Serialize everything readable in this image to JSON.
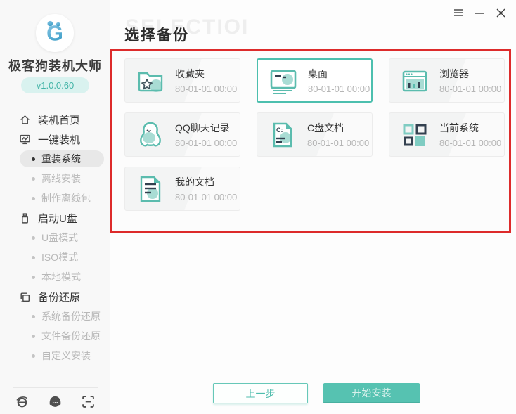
{
  "window": {
    "controls": {
      "menu": "menu",
      "minimize": "minimize",
      "close": "close"
    }
  },
  "sidebar": {
    "brand": "极客狗装机大师",
    "version": "v1.0.0.60",
    "nav": [
      {
        "label": "装机首页",
        "type": "section",
        "icon": "home-icon"
      },
      {
        "label": "一键装机",
        "type": "section",
        "icon": "monitor-icon"
      },
      {
        "label": "重装系统",
        "type": "sub",
        "selected": true
      },
      {
        "label": "离线安装",
        "type": "sub"
      },
      {
        "label": "制作离线包",
        "type": "sub"
      },
      {
        "label": "启动U盘",
        "type": "section",
        "icon": "usb-icon"
      },
      {
        "label": "U盘模式",
        "type": "sub"
      },
      {
        "label": "ISO模式",
        "type": "sub"
      },
      {
        "label": "本地模式",
        "type": "sub"
      },
      {
        "label": "备份还原",
        "type": "section",
        "icon": "restore-icon"
      },
      {
        "label": "系统备份还原",
        "type": "sub"
      },
      {
        "label": "文件备份还原",
        "type": "sub"
      },
      {
        "label": "自定义安装",
        "type": "sub"
      }
    ],
    "footer_icons": [
      "ie-browser-icon",
      "customer-service-icon",
      "scan-icon"
    ]
  },
  "main": {
    "watermark": "SELECTIOI",
    "title": "选择备份",
    "cards": [
      {
        "name": "收藏夹",
        "time": "80-01-01 00:00",
        "icon": "folder-star-icon",
        "selected": false
      },
      {
        "name": "桌面",
        "time": "80-01-01 00:00",
        "icon": "desktop-icon",
        "selected": true
      },
      {
        "name": "浏览器",
        "time": "80-01-01 00:00",
        "icon": "browser-icon",
        "selected": false
      },
      {
        "name": "QQ聊天记录",
        "time": "80-01-01 00:00",
        "icon": "qq-icon",
        "selected": false
      },
      {
        "name": "C盘文档",
        "time": "80-01-01 00:00",
        "icon": "c-drive-doc-icon",
        "selected": false
      },
      {
        "name": "当前系统",
        "time": "80-01-01 00:00",
        "icon": "system-grid-icon",
        "selected": false
      },
      {
        "name": "我的文档",
        "time": "80-01-01 00:00",
        "icon": "my-docs-icon",
        "selected": false
      }
    ],
    "buttons": {
      "prev": "上一步",
      "start": "开始安装"
    }
  },
  "colors": {
    "accent_teal": "#4cbfae",
    "annotation_red": "#dd2b2b",
    "icon_navy": "#33404f",
    "icon_teal_soft": "#a9dcd4"
  }
}
